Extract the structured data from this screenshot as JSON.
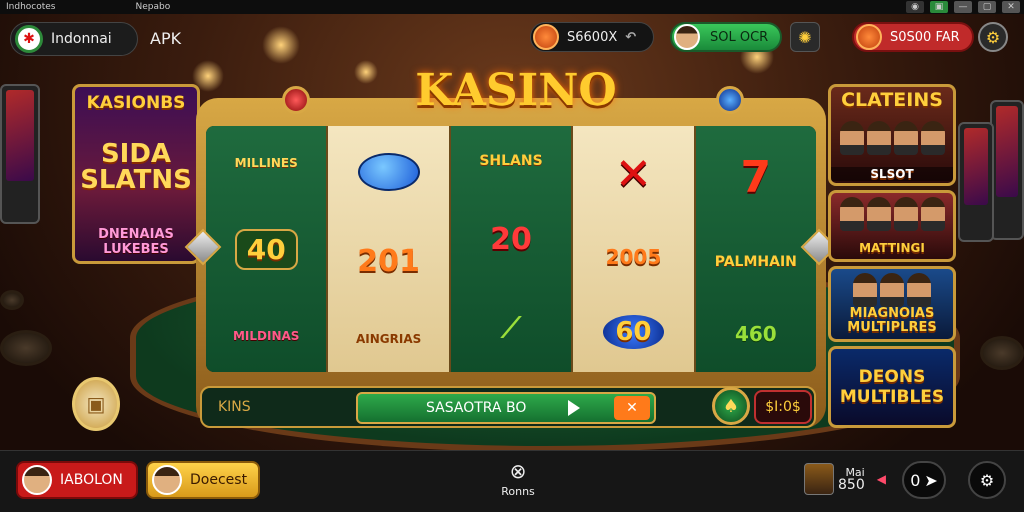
{
  "titlebar": {
    "left_text": "Indhocotes",
    "center_text": "Nepabo"
  },
  "header": {
    "app_name": "Indonnai",
    "apk_label": "APK",
    "coins_value": "S6600X",
    "cta_label": "SOL OCR",
    "balance_value": "S0S00 FAR"
  },
  "main": {
    "game_title": "KASINO",
    "left_promo": {
      "title": "KASIONBS",
      "headline": "SIDA SLATNS",
      "subtitle": "DNENAIAS LUKEBES"
    },
    "reels": [
      [
        "MILLINES",
        "40",
        "MILDINAS"
      ],
      [
        "",
        "201",
        "AINGRIAS"
      ],
      [
        "SHLANS",
        "20",
        ""
      ],
      [
        "",
        "2005",
        "60"
      ],
      [
        "",
        "PALMHAIN",
        "460"
      ]
    ],
    "right_panels": [
      "CLATEINS",
      "SLSOT",
      "MATTINGI",
      "MIAGNOIAS MULTIPLRES",
      "DEONS MULTIBLES"
    ]
  },
  "controls": {
    "left_label": "KINS",
    "spin_label": "SASAOTRA BO",
    "bet_label": "$I:0$"
  },
  "bottom": {
    "left_btn": "IABOLON",
    "deposit": "Doecest",
    "center_label": "Ronns",
    "count_top": "Mai",
    "count_bottom": "850",
    "right_counter": "0"
  }
}
